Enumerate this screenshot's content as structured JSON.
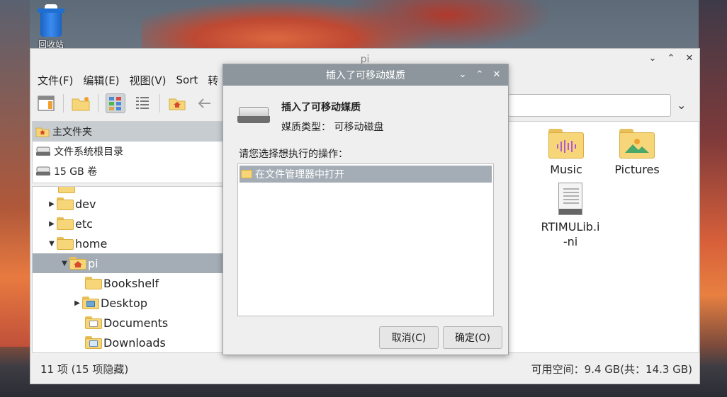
{
  "desktop": {
    "trash_label": "回收站"
  },
  "file_manager": {
    "title": "pi",
    "menu": [
      "文件(F)",
      "编辑(E)",
      "视图(V)",
      "Sort",
      "转"
    ],
    "places": [
      {
        "label": "主文件夹",
        "icon": "home-icon"
      },
      {
        "label": "文件系统根目录",
        "icon": "drive-icon"
      },
      {
        "label": "15 GB 卷",
        "icon": "drive-icon"
      }
    ],
    "tree": [
      {
        "label": "dev",
        "expander": "▶",
        "indent": 1
      },
      {
        "label": "etc",
        "expander": "▶",
        "indent": 1
      },
      {
        "label": "home",
        "expander": "▼",
        "indent": 1
      },
      {
        "label": "pi",
        "expander": "▼",
        "indent": 2
      },
      {
        "label": "Bookshelf",
        "expander": "",
        "indent": 3
      },
      {
        "label": "Desktop",
        "expander": "▶",
        "indent": 3
      },
      {
        "label": "Documents",
        "expander": "",
        "indent": 3
      },
      {
        "label": "Downloads",
        "expander": "",
        "indent": 3
      }
    ],
    "files": [
      {
        "label": "Music",
        "type": "folder"
      },
      {
        "label": "Pictures",
        "type": "folder"
      },
      {
        "label": "RTIMULib.i-ni",
        "type": "document"
      }
    ],
    "status_left": "11 项 (15 项隐藏)",
    "status_right": "可用空间：9.4 GB(共：14.3 GB)"
  },
  "dialog": {
    "title": "插入了可移动媒质",
    "heading": "插入了可移动媒质",
    "media_type": "媒质类型：  可移动磁盘",
    "prompt": "请您选择想执行的操作：",
    "action": "在文件管理器中打开",
    "cancel_label": "取消(C)",
    "ok_label": "确定(O)"
  },
  "colors": {
    "selection": "#a4adb5",
    "dialog_titlebar": "#8d969c",
    "folder": "#f7d67a"
  }
}
